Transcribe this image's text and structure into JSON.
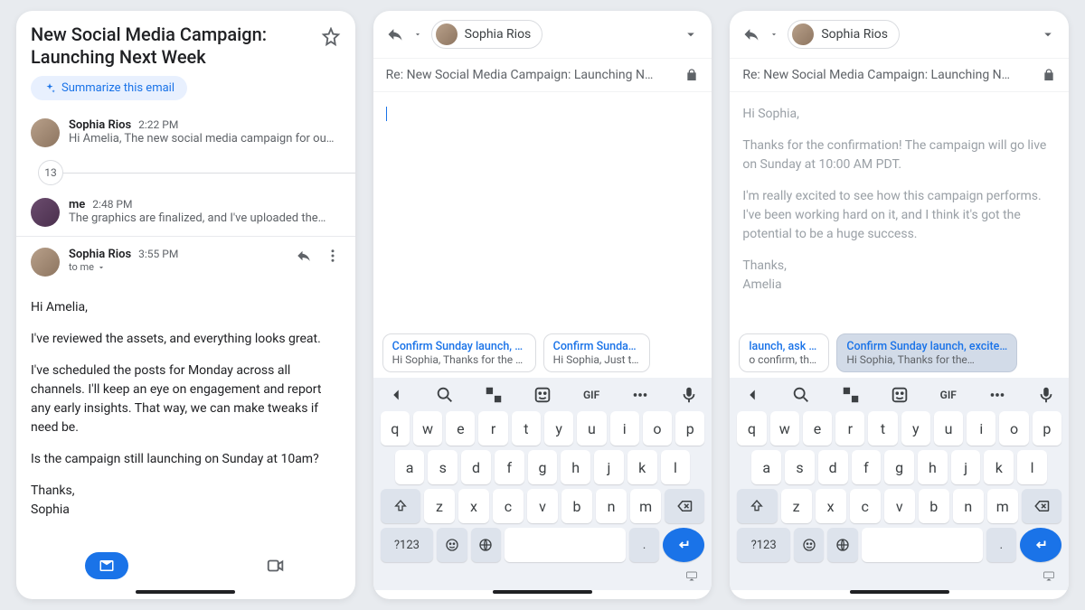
{
  "screen1": {
    "title": "New Social Media Campaign: Launching Next Week",
    "summarize_label": "Summarize this email",
    "thread": {
      "msg1": {
        "sender": "Sophia Rios",
        "time": "2:22 PM",
        "preview": "Hi Amelia, The new social media campaign for ou…"
      },
      "collapsed_count": "13",
      "msg2": {
        "sender": "me",
        "time": "2:48 PM",
        "preview": "The graphics are finalized, and I've uploaded the…"
      },
      "msg3": {
        "sender": "Sophia Rios",
        "time": "3:55 PM",
        "to": "to me"
      }
    },
    "body": {
      "greet": "Hi Amelia,",
      "p1": "I've reviewed the assets, and everything looks great.",
      "p2": "I've scheduled the posts for Monday across all channels. I'll keep an eye on engagement and report any early insights. That way, we can make tweaks if need be.",
      "p3": "Is the campaign still launching on Sunday at 10am?",
      "signoff": "Thanks,",
      "name": "Sophia"
    }
  },
  "screen2": {
    "recipient": "Sophia Rios",
    "subject": "Re: New Social Media Campaign: Launching N…",
    "suggestions": {
      "s1": {
        "title": "Confirm Sunday launch, sugge…",
        "preview": "Hi Sophia, Thanks for the updat…"
      },
      "s2": {
        "title": "Confirm Sunday la",
        "preview": "Hi Sophia, Just to c"
      }
    }
  },
  "screen3": {
    "recipient": "Sophia Rios",
    "subject": "Re: New Social Media Campaign: Launching N…",
    "body": {
      "greet": "Hi Sophia,",
      "p1": "Thanks for the confirmation! The campaign will go live on Sunday at 10:00 AM PDT.",
      "p2": "I'm really excited to see how this campaign performs. I've been working hard on it, and I think it's got the potential to be a huge success.",
      "signoff": "Thanks,",
      "name": "Amelia"
    },
    "suggestions": {
      "s1": {
        "title": "launch, ask goals",
        "preview": "o confirm, the…"
      },
      "s2": {
        "title": "Confirm Sunday launch, excited.",
        "preview": "Hi Sophia, Thanks for the…"
      }
    }
  },
  "keyboard": {
    "gif": "GIF",
    "row1": [
      "q",
      "w",
      "e",
      "r",
      "t",
      "y",
      "u",
      "i",
      "o",
      "p"
    ],
    "row2": [
      "a",
      "s",
      "d",
      "f",
      "g",
      "h",
      "j",
      "k",
      "l"
    ],
    "row3": [
      "z",
      "x",
      "c",
      "v",
      "b",
      "n",
      "m"
    ],
    "nums": "?123",
    "period": "."
  }
}
